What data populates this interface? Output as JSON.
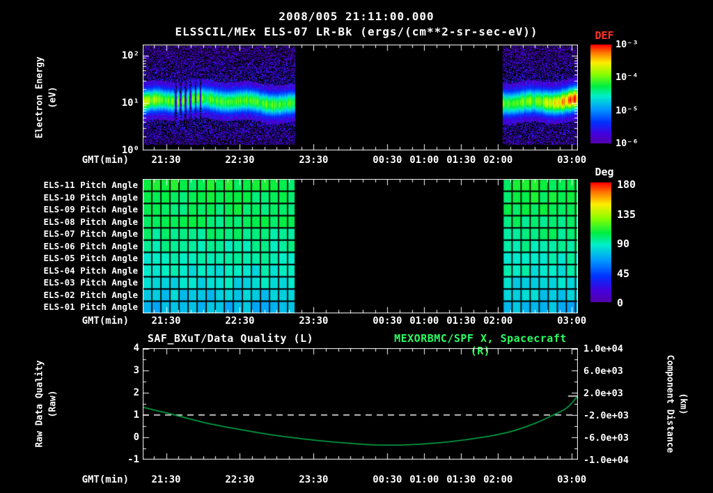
{
  "header": {
    "date_title": "2008/005 21:11:00.000",
    "plot_title": "ELSSCIL/MEx ELS-07 LR-Bk (ergs/(cm**2-sr-sec-eV))"
  },
  "axis": {
    "gmt_label": "GMT(min)",
    "x_unit": "minutes_after_21:00",
    "start_min": 11,
    "end_min": 365,
    "minor_step_min": 10,
    "ticks": [
      {
        "label": "21:30",
        "min": 30
      },
      {
        "label": "22:30",
        "min": 90
      },
      {
        "label": "23:30",
        "min": 150
      },
      {
        "label": "00:30",
        "min": 210
      },
      {
        "label": "01:00",
        "min": 240
      },
      {
        "label": "01:30",
        "min": 270
      },
      {
        "label": "02:00",
        "min": 300
      },
      {
        "label": "03:00",
        "min": 360
      }
    ]
  },
  "panel1": {
    "ylabel_line1": "Electron Energy",
    "ylabel_line2": "(eV)",
    "ytick_labels": [
      "10²",
      "10¹",
      "10⁰"
    ],
    "colorbar_title": "DEF",
    "colorbar_title_color": "#ff3322",
    "colorbar_labels": [
      "10⁻³",
      "10⁻⁴",
      "10⁻⁵",
      "10⁻⁶"
    ]
  },
  "panel2": {
    "row_labels": [
      "ELS-11 Pitch Angle",
      "ELS-10 Pitch Angle",
      "ELS-09 Pitch Angle",
      "ELS-08 Pitch Angle",
      "ELS-07 Pitch Angle",
      "ELS-06 Pitch Angle",
      "ELS-05 Pitch Angle",
      "ELS-04 Pitch Angle",
      "ELS-03 Pitch Angle",
      "ELS-02 Pitch Angle",
      "ELS-01 Pitch Angle"
    ],
    "colorbar_title": "Deg",
    "colorbar_labels": [
      "180",
      "135",
      "90",
      "45",
      "0"
    ]
  },
  "panel3": {
    "title_left": "SAF_BXuT/Data Quality (L)",
    "title_right": "MEXORBMC/SPF X, Spacecraft (R)",
    "title_right_color": "#2bff62",
    "ylabel_line1": "Raw Data Quality",
    "ylabel_line2": "(Raw)",
    "y2label_line1": "Component Distance",
    "y2label_line2": "(km)",
    "ytick_labels_left": [
      "4",
      "3",
      "2",
      "1",
      "0",
      "-1"
    ],
    "ytick_labels_right": [
      "1.0e+04",
      "6.0e+03",
      "2.0e+03",
      "-2.0e+03",
      "-6.0e+03",
      "-1.0e+04"
    ]
  },
  "colors": {
    "background": "#000000",
    "text": "#ffffff",
    "def_title_red": "#ff3322",
    "right_title_green": "#2bff62",
    "spacecraft_line_green": "#00b44c"
  },
  "chart_data": [
    {
      "type": "heatmap",
      "name": "electron-energy-spectrogram",
      "title": "ELSSCIL/MEx ELS-07 LR-Bk",
      "units": "ergs/(cm**2-sr-sec-eV)",
      "xlabel": "GMT(min)",
      "x_start": "21:11",
      "x_end": "03:05",
      "x_tick_labels": [
        "21:30",
        "22:30",
        "23:30",
        "00:30",
        "01:00",
        "01:30",
        "02:00",
        "03:00"
      ],
      "ylabel": "Electron Energy (eV)",
      "yscale": "log",
      "ylim_ev": [
        1,
        174
      ],
      "ylim_log_top": 2.24,
      "colorbar": {
        "title": "DEF",
        "scale": "log",
        "min": 1e-06,
        "max": 0.001,
        "tick_labels": [
          "10⁻³",
          "10⁻⁴",
          "10⁻⁵",
          "10⁻⁶"
        ]
      },
      "segments": [
        {
          "start": "21:11",
          "end": "23:15",
          "start_min": 11,
          "end_min": 135,
          "band_center_log": 1.03,
          "band_sigma": 0.17,
          "band_amp": 0.62,
          "peak_flux": 0.0001,
          "ramp": false
        },
        {
          "start": "02:04",
          "end": "03:05",
          "start_min": 304,
          "end_min": 365,
          "band_center_log": 1.07,
          "band_sigma": 0.18,
          "band_amp": 0.64,
          "peak_flux": 0.00012,
          "ramp": true
        }
      ],
      "gap": {
        "start": "23:15",
        "end": "02:04"
      },
      "dropouts_min": [
        38,
        42,
        46,
        50,
        54,
        58
      ],
      "description": "Bright electron flux band near 8-20 eV (~1e-4 DEF) over weak 1e-6..1e-5 background; telemetry gap 23:15-02:04; band brightens toward 03:00"
    },
    {
      "type": "heatmap",
      "name": "pitch-angle-panels",
      "row_labels": [
        "ELS-11 Pitch Angle",
        "ELS-10 Pitch Angle",
        "ELS-09 Pitch Angle",
        "ELS-08 Pitch Angle",
        "ELS-07 Pitch Angle",
        "ELS-06 Pitch Angle",
        "ELS-05 Pitch Angle",
        "ELS-04 Pitch Angle",
        "ELS-03 Pitch Angle",
        "ELS-02 Pitch Angle",
        "ELS-01 Pitch Angle"
      ],
      "row_mean_pitch_deg": [
        105,
        103,
        101,
        99,
        96,
        93,
        90,
        86,
        82,
        77,
        71
      ],
      "colorbar": {
        "title": "Deg",
        "min": 0,
        "max": 180,
        "tick_labels": [
          "180",
          "135",
          "90",
          "45",
          "0"
        ]
      },
      "segments": [
        {
          "start": "21:11",
          "end": "23:15",
          "start_min": 11,
          "end_min": 135
        },
        {
          "start": "02:04",
          "end": "03:05",
          "start_min": 304,
          "end_min": 365
        }
      ],
      "description": "Pitch angles mostly 70-110 deg (green/cyan cells) during the two data segments, gap elsewhere"
    },
    {
      "type": "line",
      "name": "data-quality-and-spacecraft-x",
      "title_left": "SAF_BXuT/Data Quality (L)",
      "title_right": "MEXORBMC/SPF X, Spacecraft (R)",
      "xlabel": "GMT(min)",
      "ylim_left": [
        -1,
        4
      ],
      "ylim_right": [
        -10000,
        10000
      ],
      "x_unit": "minutes_after_21:00",
      "series": [
        {
          "name": "SAF_BXuT/Data Quality",
          "axis": "left",
          "color": "#ffffff",
          "style": "dashed",
          "smooth": false,
          "points": [
            [
              11,
              1
            ],
            [
              365,
              1
            ]
          ]
        },
        {
          "name": "SAF_BXuT/Data Quality end marker",
          "axis": "left",
          "color": "#ffffff",
          "style": "solid",
          "smooth": false,
          "points": [
            [
              357,
              1.85
            ],
            [
              365,
              1.85
            ]
          ]
        },
        {
          "name": "MEXORBMC/SPF X Spacecraft (km)",
          "axis": "right",
          "color": "#00b44c",
          "style": "solid",
          "smooth": true,
          "points": [
            [
              11,
              -600
            ],
            [
              30,
              -1600
            ],
            [
              60,
              -3300
            ],
            [
              90,
              -4600
            ],
            [
              120,
              -5700
            ],
            [
              150,
              -6500
            ],
            [
              180,
              -7100
            ],
            [
              205,
              -7400
            ],
            [
              230,
              -7300
            ],
            [
              260,
              -6800
            ],
            [
              290,
              -5900
            ],
            [
              310,
              -5000
            ],
            [
              330,
              -3500
            ],
            [
              345,
              -2000
            ],
            [
              356,
              -700
            ],
            [
              365,
              1400
            ]
          ]
        }
      ]
    }
  ]
}
